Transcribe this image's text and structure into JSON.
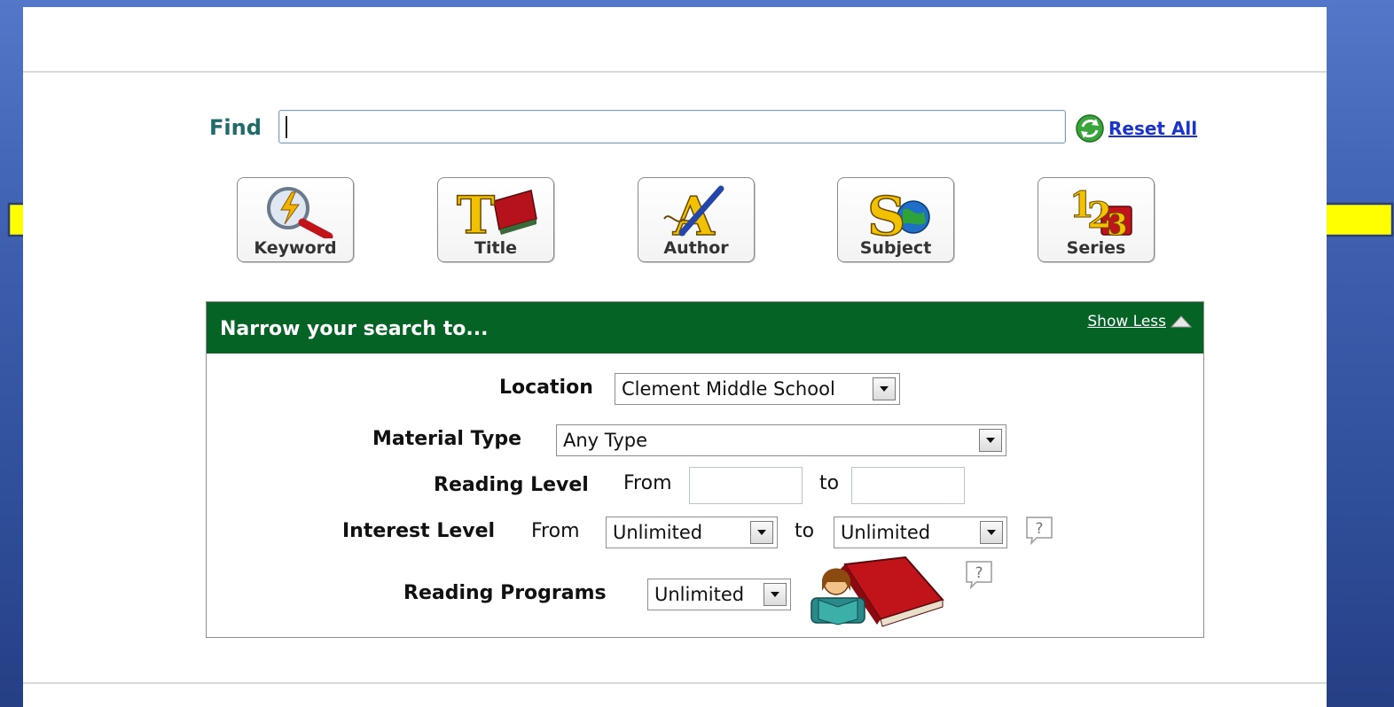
{
  "find": {
    "label": "Find",
    "value": "",
    "placeholder": ""
  },
  "reset_all": {
    "label": "Reset All"
  },
  "search_buttons": [
    {
      "label": "Keyword",
      "icon": "magnifier-lightning-icon"
    },
    {
      "label": "Title",
      "icon": "book-title-icon"
    },
    {
      "label": "Author",
      "icon": "pen-letter-a-icon"
    },
    {
      "label": "Subject",
      "icon": "globe-letter-s-icon"
    },
    {
      "label": "Series",
      "icon": "numbers-123-icon"
    }
  ],
  "narrow": {
    "title": "Narrow your search to...",
    "show_less": "Show Less",
    "location": {
      "label": "Location",
      "value": "Clement Middle School"
    },
    "material_type": {
      "label": "Material Type",
      "value": "Any Type"
    },
    "reading_level": {
      "label": "Reading Level",
      "from": "From",
      "to": "to",
      "from_value": "",
      "to_value": ""
    },
    "interest_level": {
      "label": "Interest Level",
      "from": "From",
      "from_value": "Unlimited",
      "to": "to",
      "to_value": "Unlimited"
    },
    "reading_programs": {
      "label": "Reading Programs",
      "value": "Unlimited"
    }
  },
  "colors": {
    "header_green": "#056326",
    "find_label": "#1f6b6b",
    "link_blue": "#1a33cc",
    "arrow_yellow": "#ffff00",
    "background_blue": "#3d5fae"
  }
}
